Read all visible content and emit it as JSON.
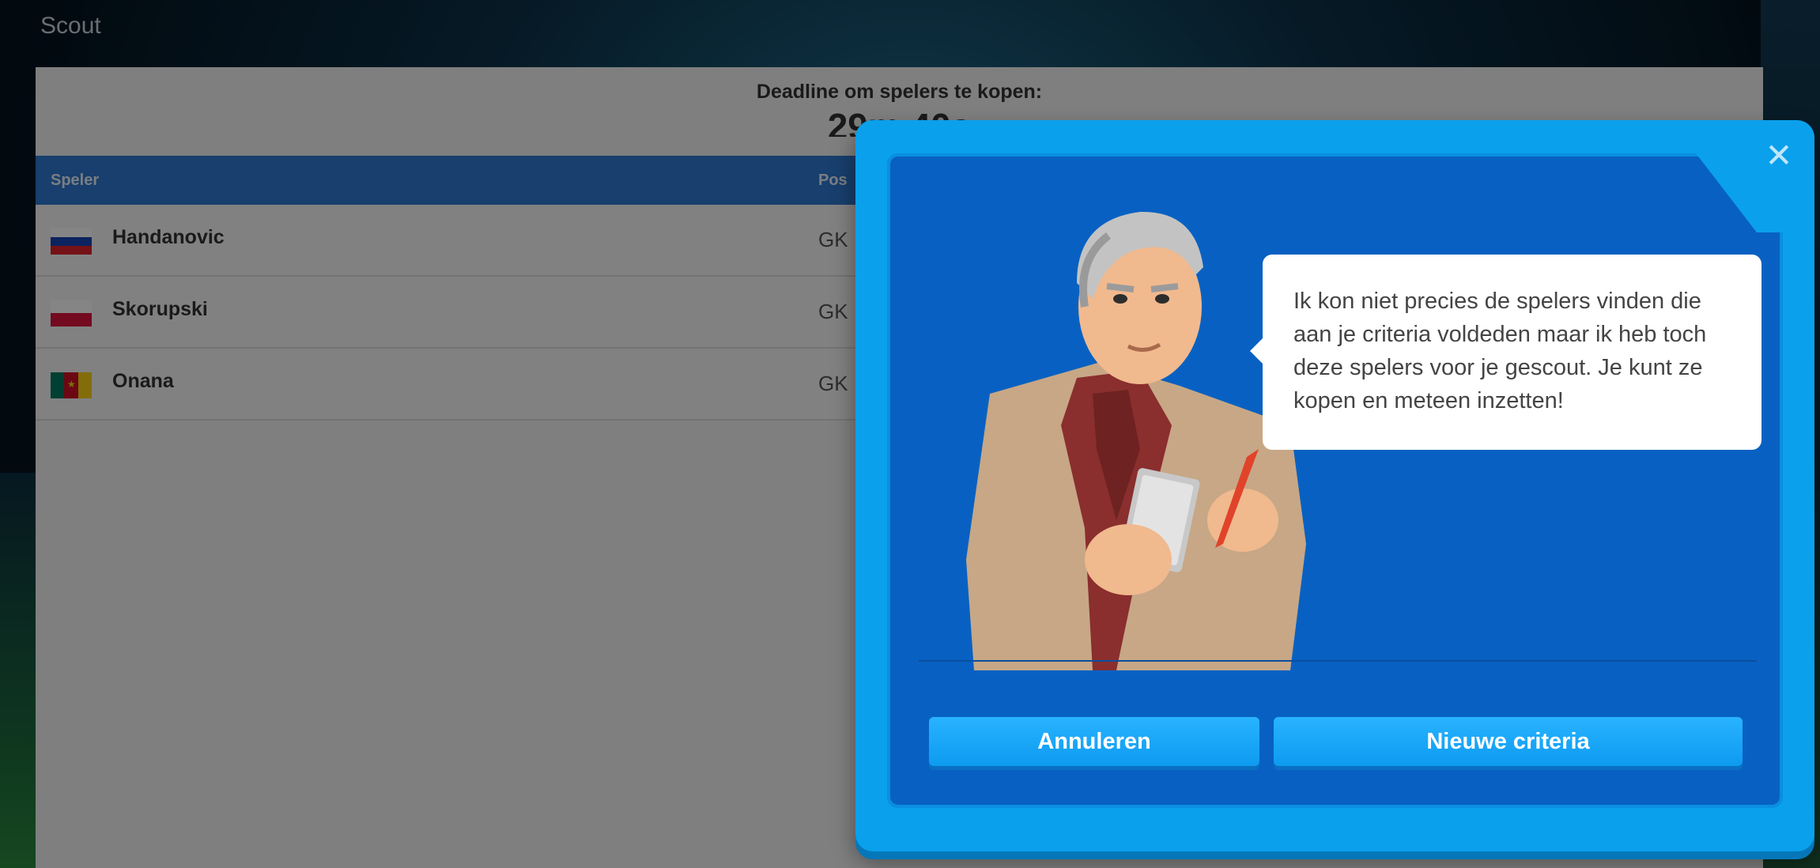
{
  "screen": {
    "title": "Scout"
  },
  "deadline": {
    "label": "Deadline om spelers te kopen:",
    "time": "29m 40s"
  },
  "table": {
    "headers": {
      "player": "Speler",
      "position": "Pos"
    },
    "rows": [
      {
        "name": "Handanovic",
        "pos": "GK",
        "flag": "slovenia-flag"
      },
      {
        "name": "Skorupski",
        "pos": "GK",
        "flag": "poland-flag"
      },
      {
        "name": "Onana",
        "pos": "GK",
        "flag": "cameroon-flag"
      }
    ]
  },
  "dialog": {
    "message": "Ik kon niet precies de spelers vinden die aan je criteria voldeden maar ik heb toch deze spelers voor je gescout. Je kunt ze kopen en meteen inzetten!",
    "cancel_label": "Annuleren",
    "confirm_label": "Nieuwe criteria",
    "close_icon": "close-icon"
  },
  "colors": {
    "dialog_outer": "#0aa0ec",
    "dialog_inner": "#0861c2",
    "button": "#0d9bf0",
    "table_header": "#2e7ad1"
  }
}
